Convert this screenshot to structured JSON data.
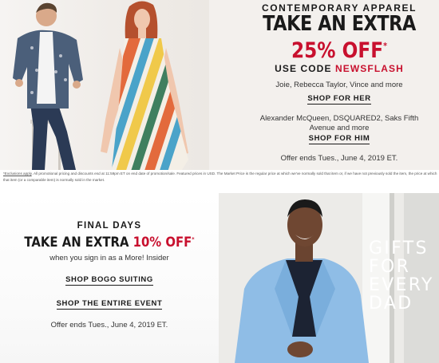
{
  "banner1": {
    "eyebrow": "CONTEMPORARY APPAREL",
    "headline": "TAKE AN EXTRA",
    "discount": "25% OFF",
    "asterisk": "*",
    "code_prefix": "USE CODE ",
    "code_word": "NEWSFLASH",
    "brands_her": "Joie, Rebecca Taylor, Vince and more",
    "link_her": "SHOP FOR HER",
    "brands_him": "Alexander McQueen, DSQUARED2, Saks Fifth Avenue and more",
    "link_him": "SHOP FOR HIM",
    "offer": "Offer ends Tues., June 4, 2019 ET.",
    "colors": {
      "accent_red": "#c8102e",
      "background": "#f3f0ed"
    }
  },
  "fineprint": {
    "exclusions": "*Exclusions apply",
    "text": ". All promotional pricing and discounts end at 11:59pm ET on end date of promotion/sale. Featured prices in USD. The Market Price is the regular price at which we've normally sold that item or, if we have not previously sold the item, the price at which that item (or a comparable item) is normally sold in the market."
  },
  "banner2": {
    "final_days": "FINAL DAYS",
    "headline_lead": "TAKE AN EXTRA ",
    "headline_pct": "10% OFF",
    "asterisk": "*",
    "signin": "when you sign in as a More! Insider",
    "link_bogo": "SHOP BOGO SUITING",
    "link_event": "SHOP THE ENTIRE EVENT",
    "offer": "Offer ends Tues., June 4, 2019 ET.",
    "gifts_lines": [
      "GIFTS",
      "FOR",
      "EVERY",
      "DAD"
    ]
  }
}
